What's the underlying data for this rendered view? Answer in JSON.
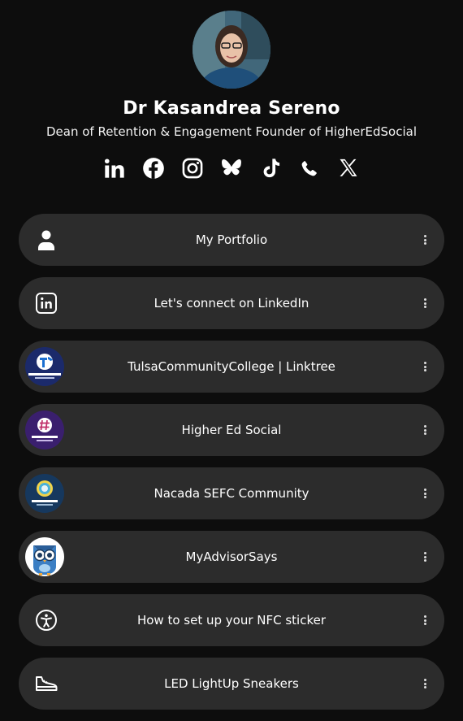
{
  "profile": {
    "name": "Dr Kasandrea Sereno",
    "bio": "Dean of Retention & Engagement Founder of HigherEdSocial"
  },
  "socials": [
    {
      "icon": "linkedin-icon"
    },
    {
      "icon": "facebook-icon"
    },
    {
      "icon": "instagram-icon"
    },
    {
      "icon": "bluesky-icon"
    },
    {
      "icon": "tiktok-icon"
    },
    {
      "icon": "phone-icon"
    },
    {
      "icon": "x-icon"
    }
  ],
  "links": [
    {
      "label": "My Portfolio",
      "icon": "person-icon"
    },
    {
      "label": "Let's connect on LinkedIn",
      "icon": "linkedin-icon"
    },
    {
      "label": "TulsaCommunityCollege | Linktree",
      "icon": "tcc-thumbnail",
      "thumb_bg": "#1b2a6b"
    },
    {
      "label": "Higher Ed Social",
      "icon": "higher-ed-social-thumbnail",
      "thumb_bg": "#3a1f6e"
    },
    {
      "label": "Nacada SEFC Community",
      "icon": "nacada-thumbnail",
      "thumb_bg": "#16385e"
    },
    {
      "label": "MyAdvisorSays",
      "icon": "owl-thumbnail",
      "thumb_bg": "#ffffff"
    },
    {
      "label": "How to set up your NFC sticker",
      "icon": "accessibility-icon"
    },
    {
      "label": "LED LightUp Sneakers",
      "icon": "sneaker-icon"
    }
  ]
}
